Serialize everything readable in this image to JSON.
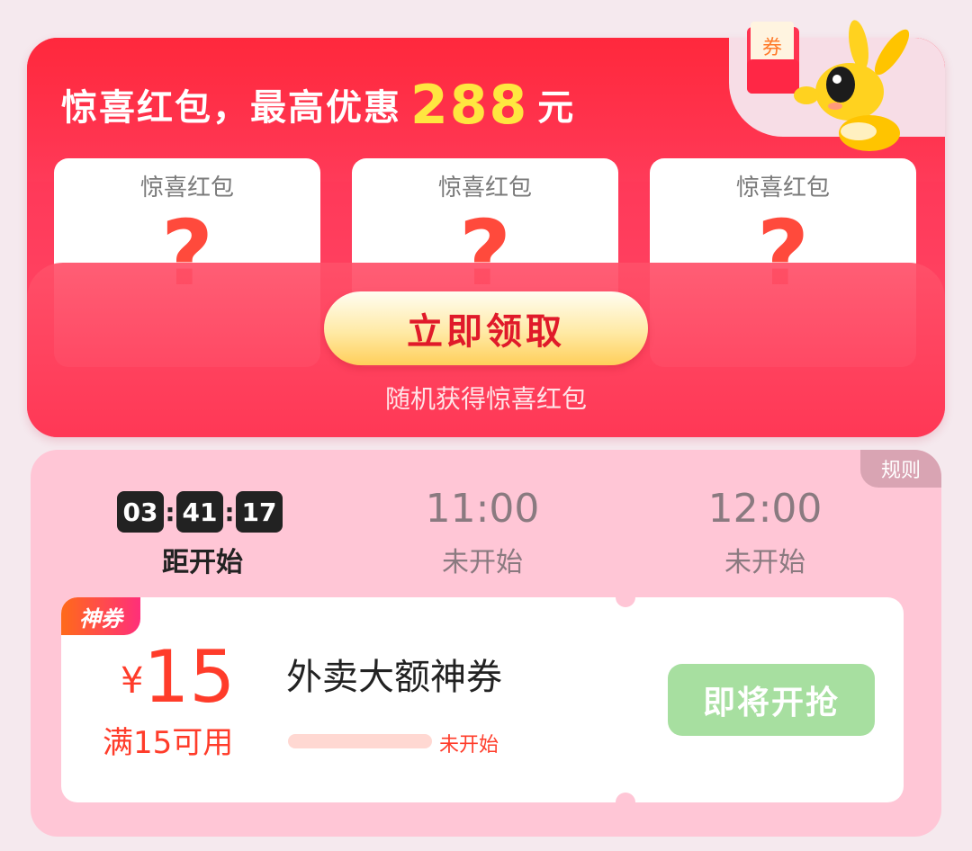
{
  "red_packet": {
    "title_prefix": "惊喜红包，最高优惠",
    "max_amount": "288",
    "unit": "元",
    "slots": [
      {
        "label": "惊喜红包",
        "mark": "?"
      },
      {
        "label": "惊喜红包",
        "mark": "?"
      },
      {
        "label": "惊喜红包",
        "mark": "?"
      }
    ],
    "claim_button": "立即领取",
    "subtitle": "随机获得惊喜红包",
    "mascot_tag": "券"
  },
  "flash_sale": {
    "rules_label": "规则",
    "countdown": {
      "hours": "03",
      "minutes": "41",
      "seconds": "17",
      "caption": "距开始"
    },
    "sessions": [
      {
        "time": "11:00",
        "status": "未开始"
      },
      {
        "time": "12:00",
        "status": "未开始"
      }
    ],
    "coupon": {
      "badge": "神券",
      "currency": "¥",
      "amount": "15",
      "threshold": "满15可用",
      "title": "外卖大额神券",
      "progress_label": "未开始",
      "progress_fraction": 0,
      "button": "即将开抢"
    }
  },
  "colors": {
    "accent_red": "#ff2d48",
    "price_red": "#ff3c2a",
    "highlight_yellow": "#ffe640",
    "card_pink": "#ffc6d6",
    "disabled_green": "#a7dfa0"
  }
}
